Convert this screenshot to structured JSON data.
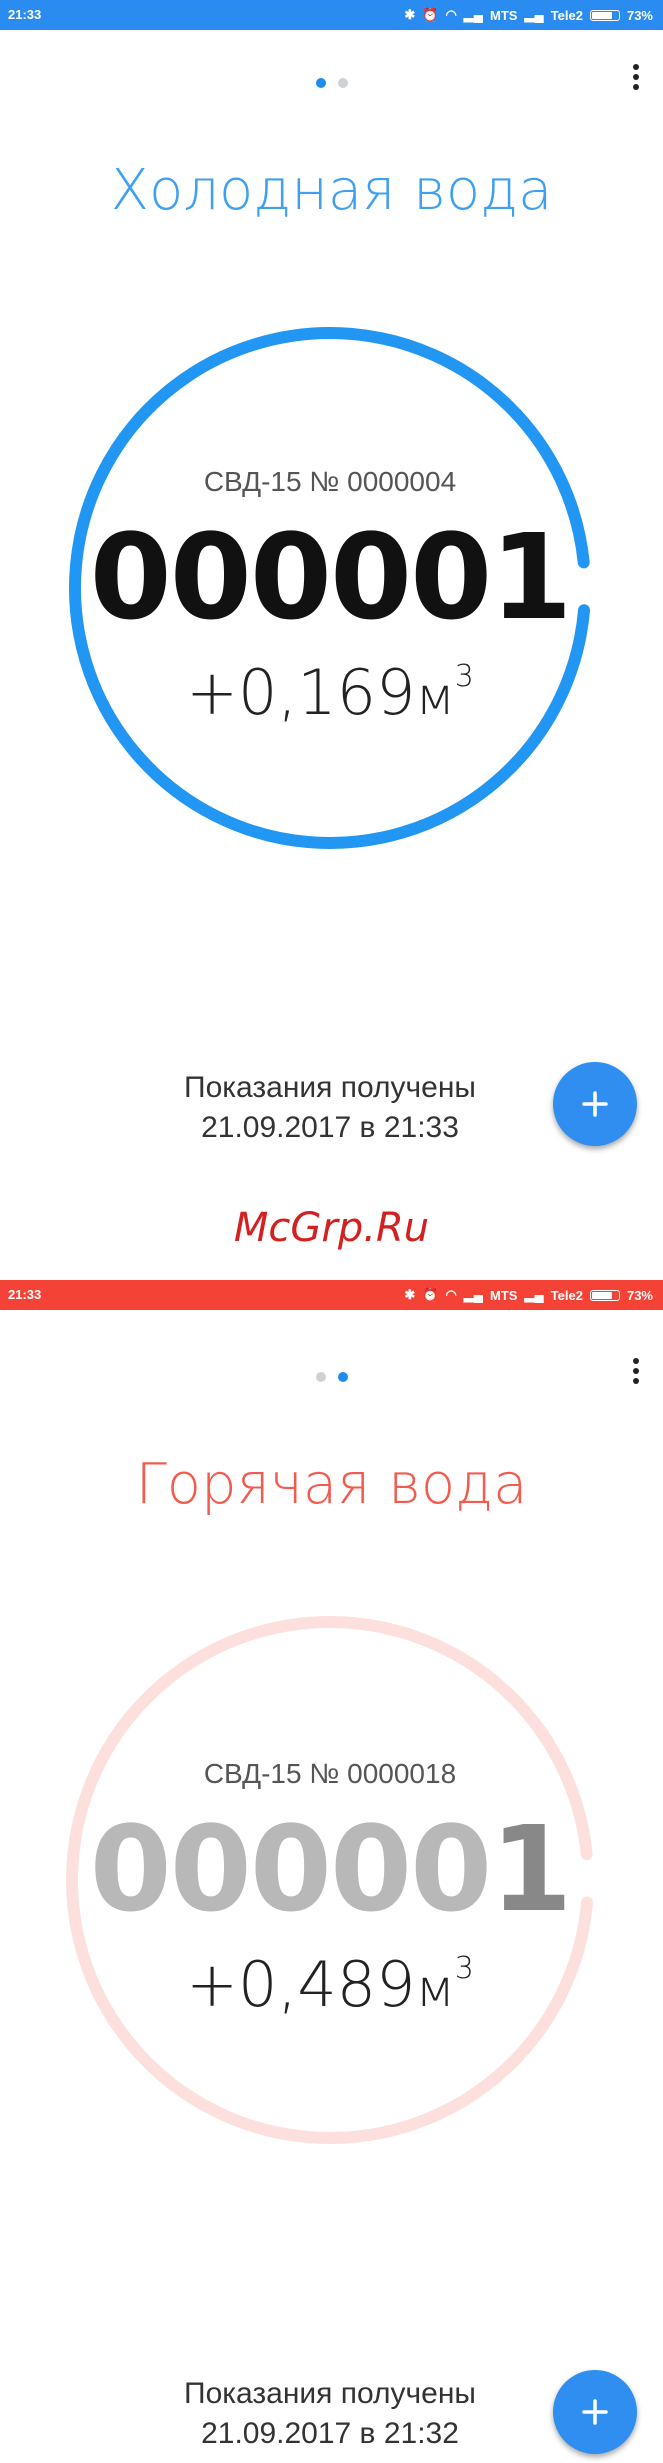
{
  "watermark": "McGrp.Ru",
  "screens": [
    {
      "status": {
        "time": "21:33",
        "carrier1": "MTS",
        "carrier2": "Tele2",
        "battery": "73%",
        "battery_level": 0.73,
        "color": "#2a8cf0"
      },
      "page_indicator": {
        "total": 2,
        "active": 0
      },
      "title": "Холодная вода",
      "title_color": "#3fa0f0",
      "meter": {
        "serial": "СВД-15 № 0000004",
        "reading": "000001",
        "delta": "+0,169",
        "unit": "м",
        "unit_sup": "3",
        "progress": 0.97,
        "ring_color": "#2196f3",
        "reading_color": "#111111"
      },
      "received": {
        "line1": "Показания получены",
        "line2": "21.09.2017 в 21:33"
      },
      "fab_label": "+"
    },
    {
      "status": {
        "time": "21:33",
        "carrier1": "MTS",
        "carrier2": "Tele2",
        "battery": "73%",
        "battery_level": 0.73,
        "color": "#f44336"
      },
      "page_indicator": {
        "total": 2,
        "active": 1
      },
      "title": "Горячая вода",
      "title_color": "#f45b4f",
      "meter": {
        "serial": "СВД-15 № 0000018",
        "reading": "000001",
        "delta": "+0,489",
        "unit": "м",
        "unit_sup": "3",
        "progress": 0.97,
        "ring_color": "#fde0de",
        "reading_color": "#b8b8b8",
        "reading_last_color": "#888888"
      },
      "received": {
        "line1": "Показания получены",
        "line2": "21.09.2017 в 21:32"
      },
      "fab_label": "+"
    }
  ]
}
